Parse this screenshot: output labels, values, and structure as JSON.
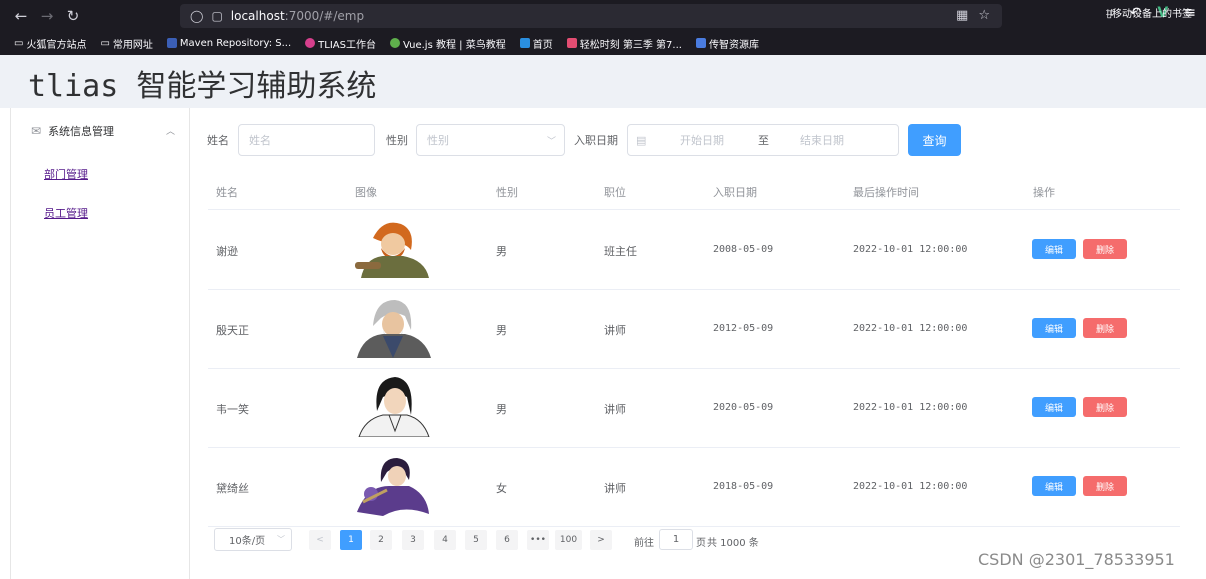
{
  "browser": {
    "url_host": "localhost",
    "url_path": ":7000/#/emp",
    "bookmarks": [
      "火狐官方站点",
      "常用网址",
      "Maven Repository: S...",
      "TLIAS工作台",
      "Vue.js 教程 | 菜鸟教程",
      "首页",
      "轻松时刻 第三季 第7...",
      "传智资源库"
    ],
    "bookmarks_right": "移动设备上的书签"
  },
  "app": {
    "title": "tlias 智能学习辅助系统"
  },
  "sidebar": {
    "menu_title": "系统信息管理",
    "items": [
      "部门管理",
      "员工管理"
    ]
  },
  "search": {
    "name_label": "姓名",
    "name_placeholder": "姓名",
    "gender_label": "性别",
    "gender_placeholder": "性别",
    "date_label": "入职日期",
    "start_placeholder": "开始日期",
    "range_sep": "至",
    "end_placeholder": "结束日期",
    "query_button": "查询"
  },
  "table": {
    "headers": [
      "姓名",
      "图像",
      "性别",
      "职位",
      "入职日期",
      "最后操作时间",
      "操作"
    ],
    "rows": [
      {
        "name": "谢逊",
        "gender": "男",
        "job": "班主任",
        "entry_date": "2008-05-09",
        "update_time": "2022-10-01 12:00:00"
      },
      {
        "name": "殷天正",
        "gender": "男",
        "job": "讲师",
        "entry_date": "2012-05-09",
        "update_time": "2022-10-01 12:00:00"
      },
      {
        "name": "韦一笑",
        "gender": "男",
        "job": "讲师",
        "entry_date": "2020-05-09",
        "update_time": "2022-10-01 12:00:00"
      },
      {
        "name": "黛绮丝",
        "gender": "女",
        "job": "讲师",
        "entry_date": "2018-05-09",
        "update_time": "2022-10-01 12:00:00"
      }
    ],
    "edit_label": "编辑",
    "delete_label": "删除"
  },
  "pagination": {
    "page_size": "10条/页",
    "prev": "<",
    "pages": [
      "1",
      "2",
      "3",
      "4",
      "5",
      "6",
      "•••",
      "100"
    ],
    "next": ">",
    "current_page": "1",
    "goto_prefix": "前往",
    "goto_value": "1",
    "goto_suffix": "页",
    "total_text": "共 1000 条"
  },
  "watermark": "CSDN @2301_78533951",
  "colors": {
    "primary": "#409eff",
    "danger": "#f56c6c",
    "header_bg": "#eef1f6"
  }
}
